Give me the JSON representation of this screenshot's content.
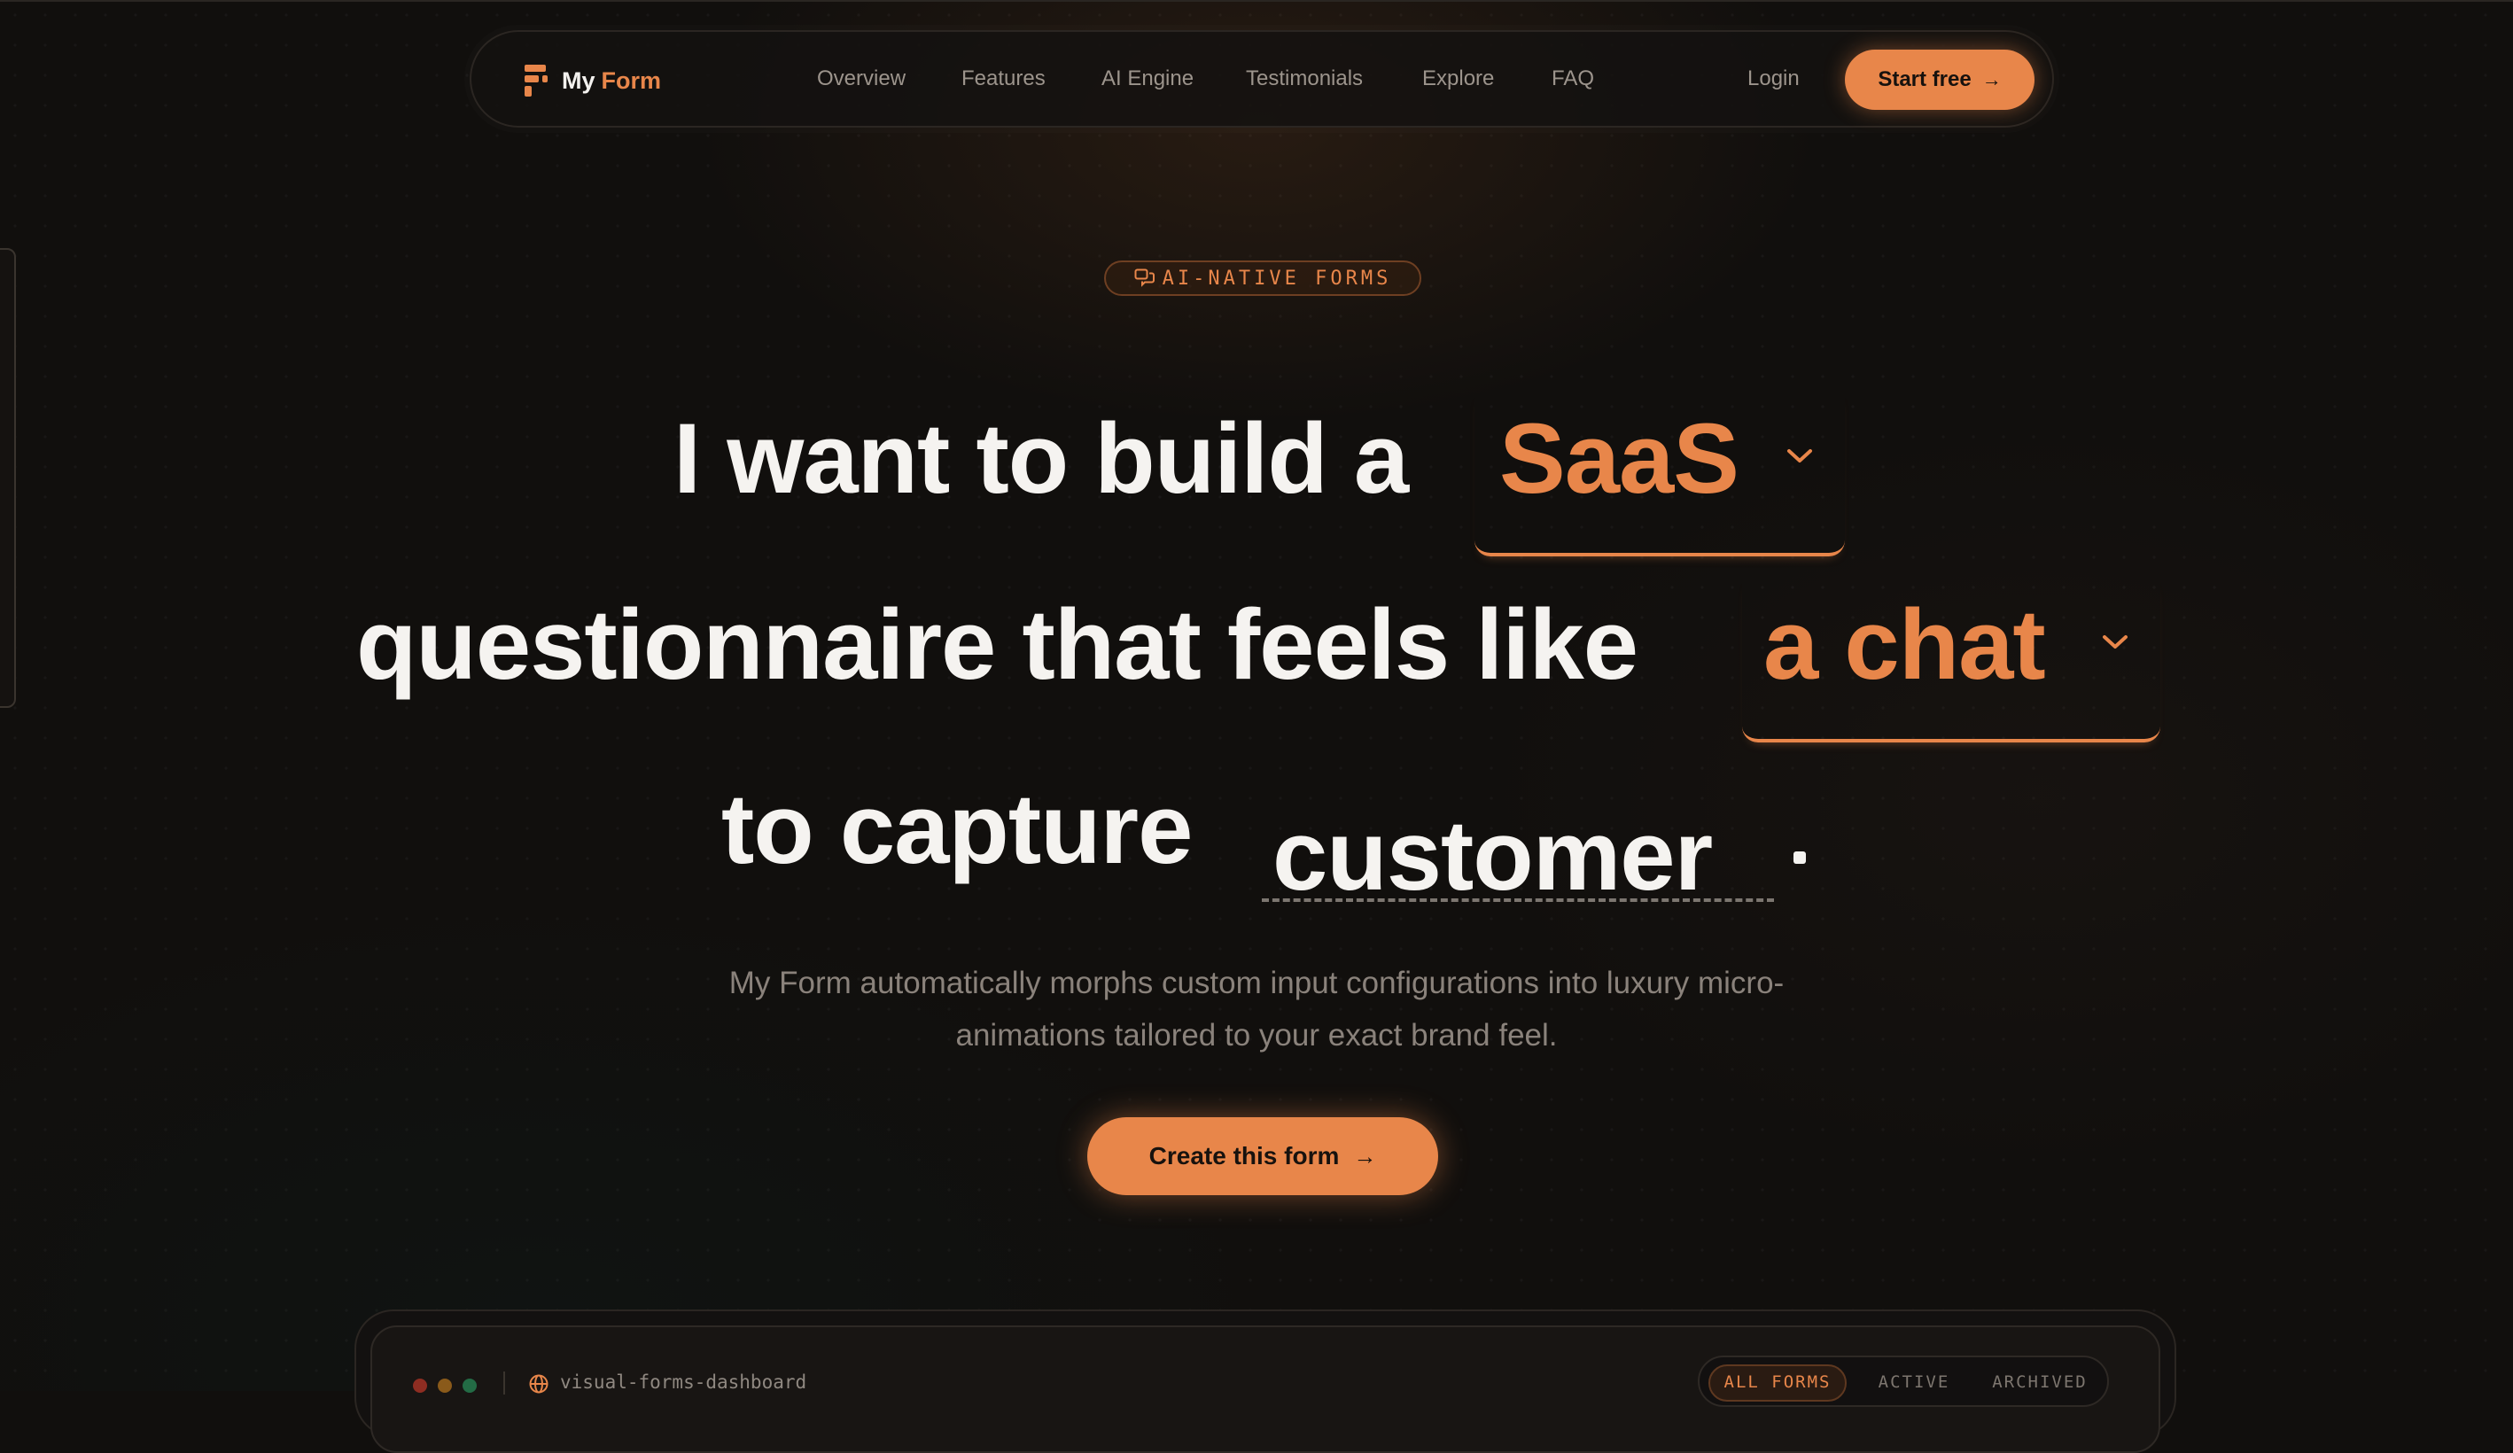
{
  "brand": {
    "name_first": "My",
    "name_second": "Form",
    "accent": "#e8864a"
  },
  "nav": {
    "links": [
      "Overview",
      "Features",
      "AI Engine",
      "Testimonials",
      "Explore",
      "FAQ"
    ],
    "login": "Login",
    "cta": "Start free"
  },
  "hero": {
    "badge": "AI-NATIVE FORMS",
    "line1": "I want to build a",
    "choice1": "SaaS",
    "line2": "questionnaire that feels like",
    "choice2": "a chat",
    "line3": "to capture",
    "typed": "customer",
    "subtitle": "My Form automatically morphs custom input configurations into luxury micro-animations tailored to your exact brand feel.",
    "cta": "Create this form"
  },
  "dashboard": {
    "title": "visual-forms-dashboard",
    "tabs": [
      "ALL FORMS",
      "ACTIVE",
      "ARCHIVED"
    ],
    "active_tab": "ALL FORMS",
    "window_dots": [
      "#c0392b",
      "#b7791f",
      "#2f855a"
    ]
  }
}
